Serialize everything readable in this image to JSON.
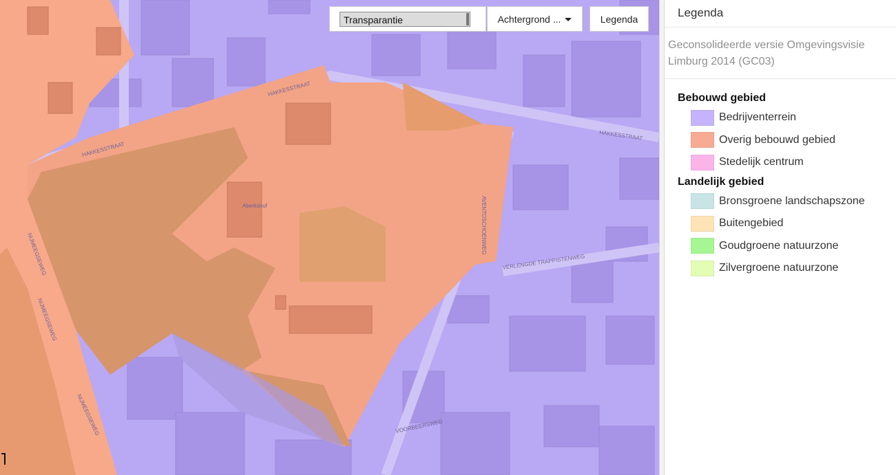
{
  "toolbar": {
    "transparency_label": "Transparantie",
    "transparency_value": 1.0,
    "background_label": "Achtergrond ...",
    "legend_button_label": "Legenda"
  },
  "map": {
    "street_labels": [
      "HAKKESSTRAAT",
      "HAKKESSTRAAT",
      "HAKKESSTRAAT",
      "NIJMEEGSEWEG",
      "NIJMEEGSEWEG",
      "NIJMEEGSEWEG",
      "VERLENGDE TRAPPISTENWEG",
      "AVENTOSCHOENWEG",
      "VOORBEERSWEG",
      "Aberkshof"
    ],
    "colors": {
      "bedrijventerrein": "#b9a8f3",
      "overig_bebouwd": "#f7a98a",
      "buitengebied": "#fcdca9"
    }
  },
  "legend": {
    "title": "Legenda",
    "subtitle": "Geconsolideerde versie Omgevingsvisie Limburg 2014 (GC03)",
    "groups": [
      {
        "name": "Bebouwd gebied",
        "items": [
          {
            "label": "Bedrijventerrein",
            "color": "#c5b3fb"
          },
          {
            "label": "Overig bebouwd gebied",
            "color": "#f8ab93"
          },
          {
            "label": "Stedelijk centrum",
            "color": "#fbb4e8"
          }
        ]
      },
      {
        "name": "Landelijk gebied",
        "items": [
          {
            "label": "Bronsgroene landschapszone",
            "color": "#c9e4e4"
          },
          {
            "label": "Buitengebied",
            "color": "#fde3b5"
          },
          {
            "label": "Goudgroene natuurzone",
            "color": "#a6f794"
          },
          {
            "label": "Zilvergroene natuurzone",
            "color": "#e3fdb4"
          }
        ]
      }
    ]
  }
}
